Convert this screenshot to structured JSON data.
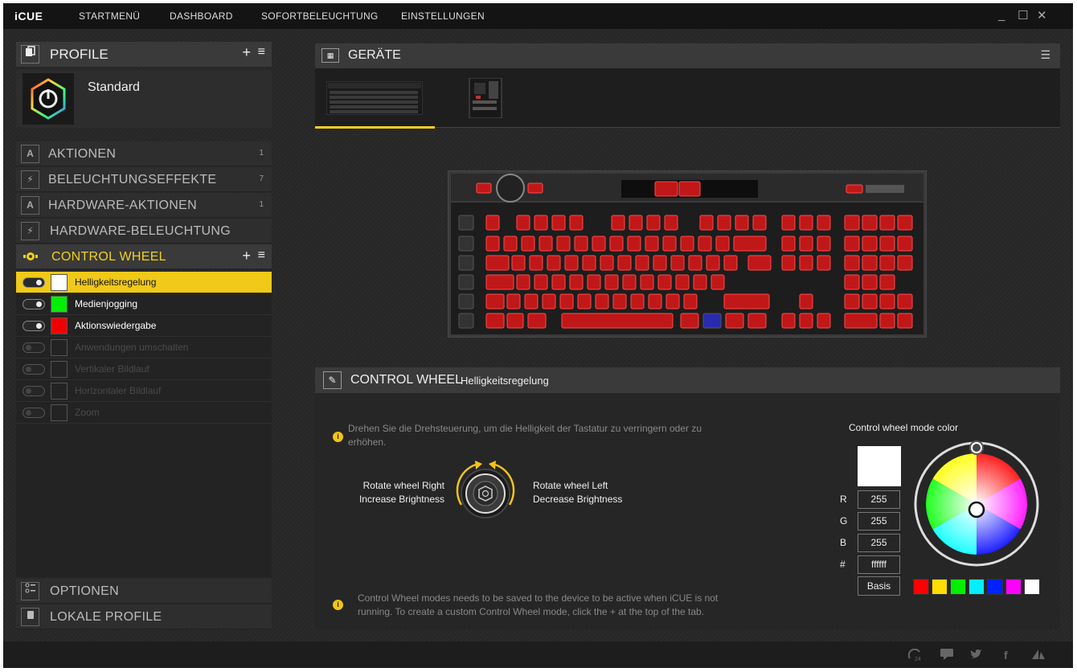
{
  "app": {
    "logo": "iCUE"
  },
  "nav": [
    "STARTMENÜ",
    "DASHBOARD",
    "SOFORTBELEUCHTUNG",
    "EINSTELLUNGEN"
  ],
  "window_controls": {
    "minimize": "_",
    "maximize": "☐",
    "close": "✕"
  },
  "profile": {
    "header": "PROFILE",
    "add": "+",
    "menu": "≡",
    "name": "Standard"
  },
  "categories": [
    {
      "label": "AKTIONEN",
      "count": "1",
      "icon": "A"
    },
    {
      "label": "BELEUCHTUNGSEFFEKTE",
      "count": "7",
      "icon": "⚡"
    },
    {
      "label": "HARDWARE-AKTIONEN",
      "count": "1",
      "icon": "A"
    },
    {
      "label": "HARDWARE-BELEUCHTUNG",
      "count": "",
      "icon": "⚡"
    },
    {
      "label": "CONTROL WHEEL",
      "count": "",
      "icon": "●"
    }
  ],
  "control_wheel_actions": {
    "add": "+",
    "menu": "≡"
  },
  "modes": [
    {
      "label": "Helligkeitsregelung",
      "color": "#ffffff",
      "enabled": true,
      "selected": true
    },
    {
      "label": "Medienjogging",
      "color": "#00ff00",
      "enabled": true,
      "selected": false
    },
    {
      "label": "Aktionswiedergabe",
      "color": "#ff0000",
      "enabled": true,
      "selected": false
    },
    {
      "label": "Anwendungen umschalten",
      "color": "#262626",
      "enabled": false,
      "selected": false
    },
    {
      "label": "Vertikaler Bildlauf",
      "color": "#262626",
      "enabled": false,
      "selected": false
    },
    {
      "label": "Horizontaler Bildlauf",
      "color": "#262626",
      "enabled": false,
      "selected": false
    },
    {
      "label": "Zoom",
      "color": "#262626",
      "enabled": false,
      "selected": false
    }
  ],
  "bottom_sections": [
    {
      "label": "OPTIONEN",
      "icon": "options-icon"
    },
    {
      "label": "LOKALE PROFILE",
      "icon": "local-profile-icon"
    }
  ],
  "devices": {
    "header": "GERÄTE",
    "menu": "☰"
  },
  "control_wheel_panel": {
    "title": "CONTROL WHEEL",
    "subtitle": "Helligkeitsregelung",
    "info1": "Drehen Sie die Drehsteuerung, um die Helligkeit der Tastatur zu verringern oder zu erhöhen.",
    "right_label_1": "Rotate wheel Right",
    "right_label_2": "Increase Brightness",
    "left_label_1": "Rotate wheel Left",
    "left_label_2": "Decrease Brightness",
    "info2": "Control Wheel modes needs to be saved to the device to be active when iCUE is not running. To create a custom Control Wheel mode, click the + at the top of the tab."
  },
  "color_picker": {
    "title": "Control wheel mode color",
    "r_label": "R",
    "g_label": "G",
    "b_label": "B",
    "hex_label": "#",
    "r": "255",
    "g": "255",
    "b": "255",
    "hex": "ffffff",
    "basis": "Basis",
    "presets": [
      "#ff0000",
      "#ffdd00",
      "#00ee00",
      "#00eeff",
      "#0022ff",
      "#ff00ff",
      "#ffffff"
    ]
  },
  "accent_color": "#f2d01a"
}
